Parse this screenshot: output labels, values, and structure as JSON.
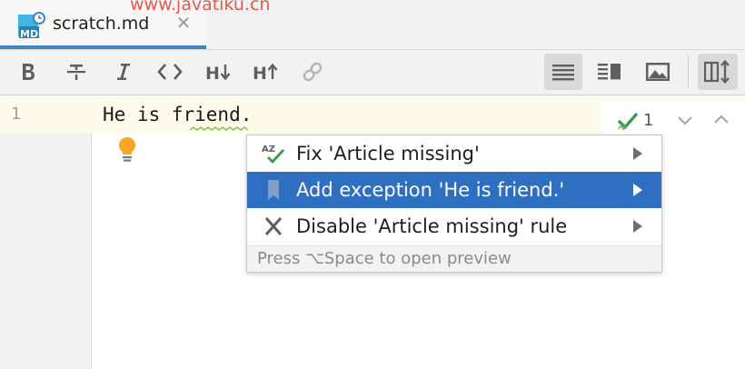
{
  "tab": {
    "title": "scratch.md",
    "icon": "markdown-file-icon",
    "file_icon_text": "MD",
    "close_icon": "close-icon"
  },
  "watermark": "www.javatiku.cn",
  "toolbar": {
    "buttons": [
      {
        "name": "bold-button",
        "icon": "bold-icon"
      },
      {
        "name": "strikethrough-button",
        "icon": "strikethrough-icon"
      },
      {
        "name": "italic-button",
        "icon": "italic-icon"
      },
      {
        "name": "code-span-button",
        "icon": "code-icon"
      },
      {
        "name": "decrease-header-button",
        "icon": "header-down-icon",
        "label": "H"
      },
      {
        "name": "increase-header-button",
        "icon": "header-up-icon",
        "label": "H"
      },
      {
        "name": "insert-link-button",
        "icon": "link-icon"
      }
    ],
    "view_buttons": [
      {
        "name": "editor-only-button",
        "icon": "editor-only-icon",
        "active": true
      },
      {
        "name": "editor-and-preview-button",
        "icon": "split-view-icon",
        "active": false
      },
      {
        "name": "preview-only-button",
        "icon": "preview-image-icon",
        "active": false
      },
      {
        "name": "sync-scroll-button",
        "icon": "scroll-sync-icon",
        "active": true
      }
    ]
  },
  "editor": {
    "line_number": "1",
    "code_line": "He is friend.",
    "inspections": {
      "count": "1",
      "icon": "check-icon"
    }
  },
  "intention_popup": {
    "items": [
      {
        "icon": "spellcheck-az-icon",
        "label": "Fix 'Article missing'",
        "selected": false
      },
      {
        "icon": "bookmark-icon",
        "label": "Add exception 'He is friend.'",
        "selected": true
      },
      {
        "icon": "x-icon",
        "label": "Disable 'Article missing' rule",
        "selected": false
      }
    ],
    "footer": "Press ⌥Space to open preview"
  },
  "colors": {
    "accent": "#4083c9",
    "selection": "#2f6fc2",
    "current_line": "#fdfbea",
    "bulb": "#f5a623"
  }
}
